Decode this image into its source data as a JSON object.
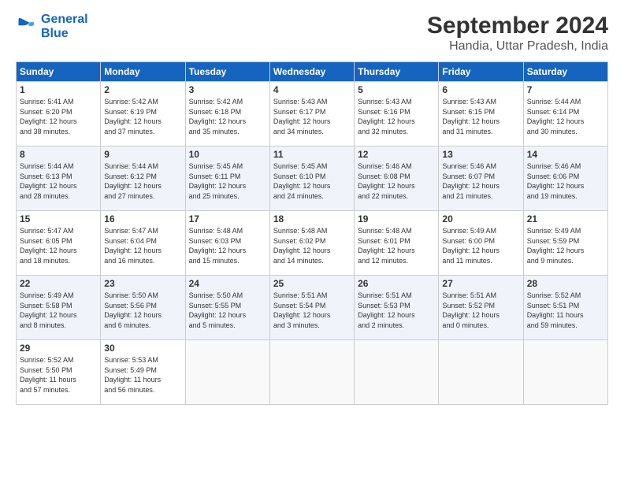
{
  "logo": {
    "line1": "General",
    "line2": "Blue"
  },
  "title": "September 2024",
  "subtitle": "Handia, Uttar Pradesh, India",
  "days_of_week": [
    "Sunday",
    "Monday",
    "Tuesday",
    "Wednesday",
    "Thursday",
    "Friday",
    "Saturday"
  ],
  "weeks": [
    [
      {
        "day": 1,
        "info": "Sunrise: 5:41 AM\nSunset: 6:20 PM\nDaylight: 12 hours\nand 38 minutes."
      },
      {
        "day": 2,
        "info": "Sunrise: 5:42 AM\nSunset: 6:19 PM\nDaylight: 12 hours\nand 37 minutes."
      },
      {
        "day": 3,
        "info": "Sunrise: 5:42 AM\nSunset: 6:18 PM\nDaylight: 12 hours\nand 35 minutes."
      },
      {
        "day": 4,
        "info": "Sunrise: 5:43 AM\nSunset: 6:17 PM\nDaylight: 12 hours\nand 34 minutes."
      },
      {
        "day": 5,
        "info": "Sunrise: 5:43 AM\nSunset: 6:16 PM\nDaylight: 12 hours\nand 32 minutes."
      },
      {
        "day": 6,
        "info": "Sunrise: 5:43 AM\nSunset: 6:15 PM\nDaylight: 12 hours\nand 31 minutes."
      },
      {
        "day": 7,
        "info": "Sunrise: 5:44 AM\nSunset: 6:14 PM\nDaylight: 12 hours\nand 30 minutes."
      }
    ],
    [
      {
        "day": 8,
        "info": "Sunrise: 5:44 AM\nSunset: 6:13 PM\nDaylight: 12 hours\nand 28 minutes."
      },
      {
        "day": 9,
        "info": "Sunrise: 5:44 AM\nSunset: 6:12 PM\nDaylight: 12 hours\nand 27 minutes."
      },
      {
        "day": 10,
        "info": "Sunrise: 5:45 AM\nSunset: 6:11 PM\nDaylight: 12 hours\nand 25 minutes."
      },
      {
        "day": 11,
        "info": "Sunrise: 5:45 AM\nSunset: 6:10 PM\nDaylight: 12 hours\nand 24 minutes."
      },
      {
        "day": 12,
        "info": "Sunrise: 5:46 AM\nSunset: 6:08 PM\nDaylight: 12 hours\nand 22 minutes."
      },
      {
        "day": 13,
        "info": "Sunrise: 5:46 AM\nSunset: 6:07 PM\nDaylight: 12 hours\nand 21 minutes."
      },
      {
        "day": 14,
        "info": "Sunrise: 5:46 AM\nSunset: 6:06 PM\nDaylight: 12 hours\nand 19 minutes."
      }
    ],
    [
      {
        "day": 15,
        "info": "Sunrise: 5:47 AM\nSunset: 6:05 PM\nDaylight: 12 hours\nand 18 minutes."
      },
      {
        "day": 16,
        "info": "Sunrise: 5:47 AM\nSunset: 6:04 PM\nDaylight: 12 hours\nand 16 minutes."
      },
      {
        "day": 17,
        "info": "Sunrise: 5:48 AM\nSunset: 6:03 PM\nDaylight: 12 hours\nand 15 minutes."
      },
      {
        "day": 18,
        "info": "Sunrise: 5:48 AM\nSunset: 6:02 PM\nDaylight: 12 hours\nand 14 minutes."
      },
      {
        "day": 19,
        "info": "Sunrise: 5:48 AM\nSunset: 6:01 PM\nDaylight: 12 hours\nand 12 minutes."
      },
      {
        "day": 20,
        "info": "Sunrise: 5:49 AM\nSunset: 6:00 PM\nDaylight: 12 hours\nand 11 minutes."
      },
      {
        "day": 21,
        "info": "Sunrise: 5:49 AM\nSunset: 5:59 PM\nDaylight: 12 hours\nand 9 minutes."
      }
    ],
    [
      {
        "day": 22,
        "info": "Sunrise: 5:49 AM\nSunset: 5:58 PM\nDaylight: 12 hours\nand 8 minutes."
      },
      {
        "day": 23,
        "info": "Sunrise: 5:50 AM\nSunset: 5:56 PM\nDaylight: 12 hours\nand 6 minutes."
      },
      {
        "day": 24,
        "info": "Sunrise: 5:50 AM\nSunset: 5:55 PM\nDaylight: 12 hours\nand 5 minutes."
      },
      {
        "day": 25,
        "info": "Sunrise: 5:51 AM\nSunset: 5:54 PM\nDaylight: 12 hours\nand 3 minutes."
      },
      {
        "day": 26,
        "info": "Sunrise: 5:51 AM\nSunset: 5:53 PM\nDaylight: 12 hours\nand 2 minutes."
      },
      {
        "day": 27,
        "info": "Sunrise: 5:51 AM\nSunset: 5:52 PM\nDaylight: 12 hours\nand 0 minutes."
      },
      {
        "day": 28,
        "info": "Sunrise: 5:52 AM\nSunset: 5:51 PM\nDaylight: 11 hours\nand 59 minutes."
      }
    ],
    [
      {
        "day": 29,
        "info": "Sunrise: 5:52 AM\nSunset: 5:50 PM\nDaylight: 11 hours\nand 57 minutes."
      },
      {
        "day": 30,
        "info": "Sunrise: 5:53 AM\nSunset: 5:49 PM\nDaylight: 11 hours\nand 56 minutes."
      },
      null,
      null,
      null,
      null,
      null
    ]
  ]
}
